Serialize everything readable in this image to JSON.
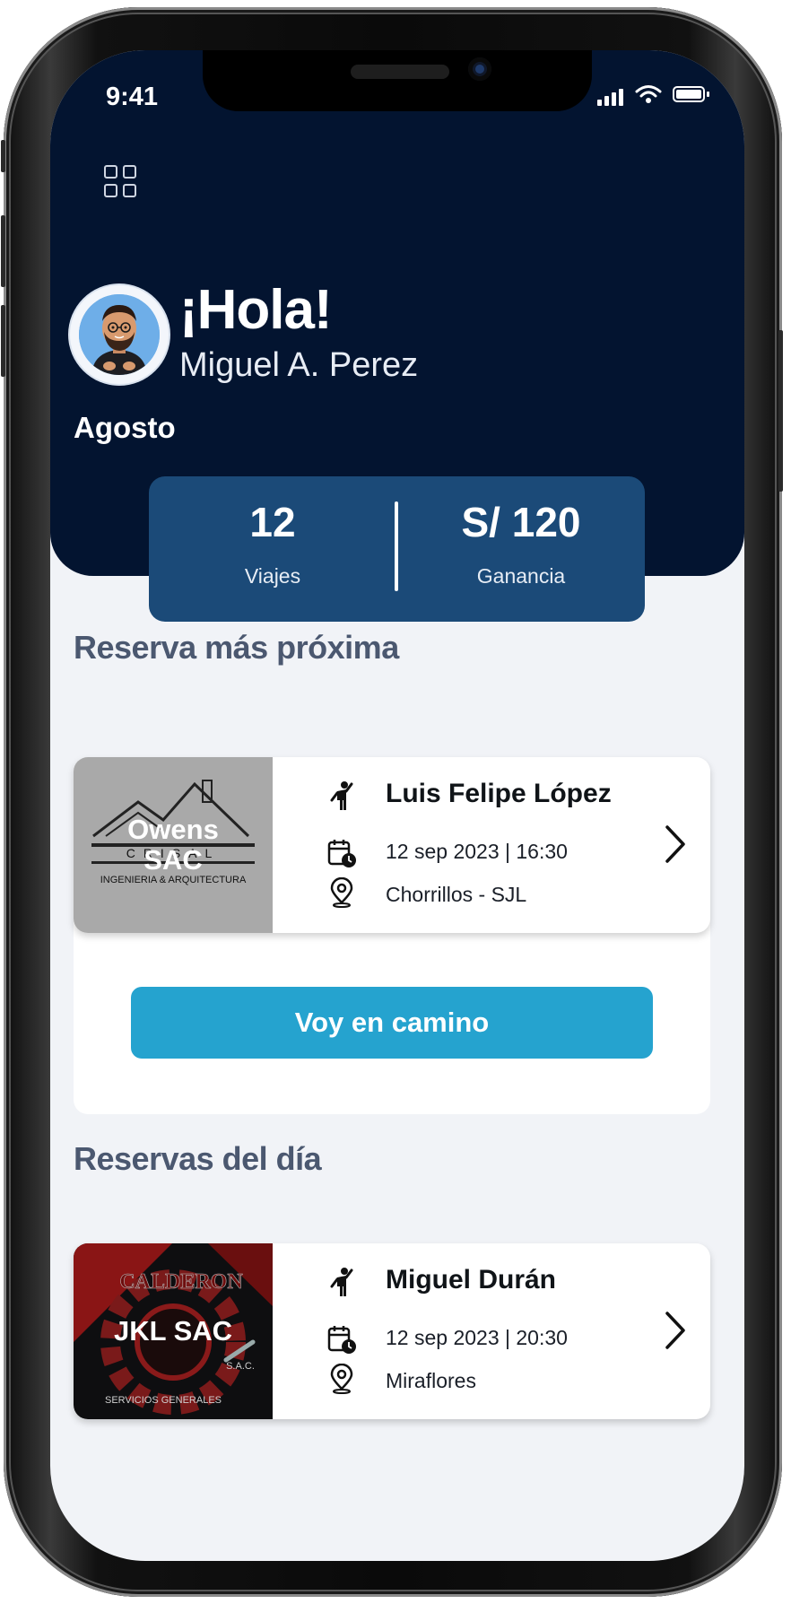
{
  "status_bar": {
    "time": "9:41"
  },
  "header": {
    "greeting": "¡Hola!",
    "user_name": "Miguel A. Perez",
    "month": "Agosto"
  },
  "stats": {
    "trips_value": "12",
    "trips_label": "Viajes",
    "earnings_value": "S/ 120",
    "earnings_label": "Ganancia"
  },
  "next_booking": {
    "section_title": "Reserva más próxima",
    "company": "Owens SAC",
    "logo_text": {
      "brand": "CRISAL",
      "tagline": "INGENIERIA & ARQUITECTURA"
    },
    "passenger": "Luis Felipe López",
    "datetime": "12 sep 2023 | 16:30",
    "route": "Chorrillos - SJL",
    "action_label": "Voy en camino"
  },
  "day_bookings": {
    "section_title": "Reservas del día",
    "items": [
      {
        "company": "JKL SAC",
        "logo_text": {
          "brand": "CALDERON",
          "tagline": "SERVICIOS GENERALES",
          "suffix": "S.A.C."
        },
        "passenger": "Miguel Durán",
        "datetime": "12 sep 2023 | 20:30",
        "route": "Miraflores"
      }
    ]
  },
  "colors": {
    "header_bg": "#031430",
    "stats_card": "#1b4a78",
    "primary_button": "#25a3cf",
    "screen_bg": "#f1f3f7"
  },
  "icons": [
    "menu-grid-icon",
    "passenger-icon",
    "calendar-clock-icon",
    "location-pin-icon",
    "chevron-right-icon"
  ]
}
